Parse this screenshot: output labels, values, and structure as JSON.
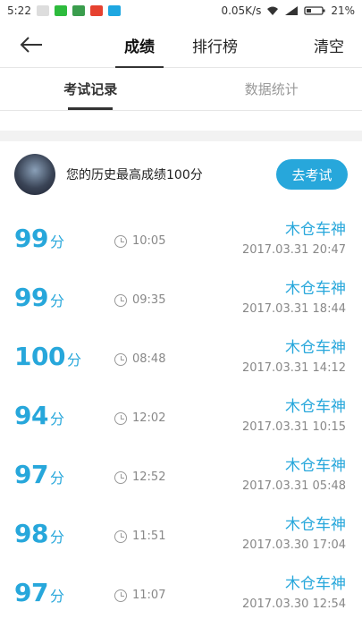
{
  "status_bar": {
    "time": "5:22",
    "speed": "0.05K/s",
    "battery": "21%",
    "icons": [
      "notification-icon",
      "wechat-icon",
      "app-icon",
      "weibo-icon",
      "play-icon",
      "wifi-icon",
      "signal-icon",
      "battery-icon"
    ]
  },
  "nav": {
    "tabs": [
      "成绩",
      "排行榜"
    ],
    "clear_label": "清空"
  },
  "sub_tabs": [
    "考试记录",
    "数据统计"
  ],
  "best": {
    "text": "您的历史最高成绩100分",
    "button": "去考试"
  },
  "records": [
    {
      "score": "99",
      "unit": "分",
      "time": "10:05",
      "name": "木仓车神",
      "datetime": "2017.03.31  20:47"
    },
    {
      "score": "99",
      "unit": "分",
      "time": "09:35",
      "name": "木仓车神",
      "datetime": "2017.03.31  18:44"
    },
    {
      "score": "100",
      "unit": "分",
      "time": "08:48",
      "name": "木仓车神",
      "datetime": "2017.03.31  14:12"
    },
    {
      "score": "94",
      "unit": "分",
      "time": "12:02",
      "name": "木仓车神",
      "datetime": "2017.03.31  10:15"
    },
    {
      "score": "97",
      "unit": "分",
      "time": "12:52",
      "name": "木仓车神",
      "datetime": "2017.03.31  05:48"
    },
    {
      "score": "98",
      "unit": "分",
      "time": "11:51",
      "name": "木仓车神",
      "datetime": "2017.03.30  17:04"
    },
    {
      "score": "97",
      "unit": "分",
      "time": "11:07",
      "name": "木仓车神",
      "datetime": "2017.03.30  12:54"
    }
  ],
  "colors": {
    "accent": "#27a7db",
    "muted": "#888888"
  }
}
